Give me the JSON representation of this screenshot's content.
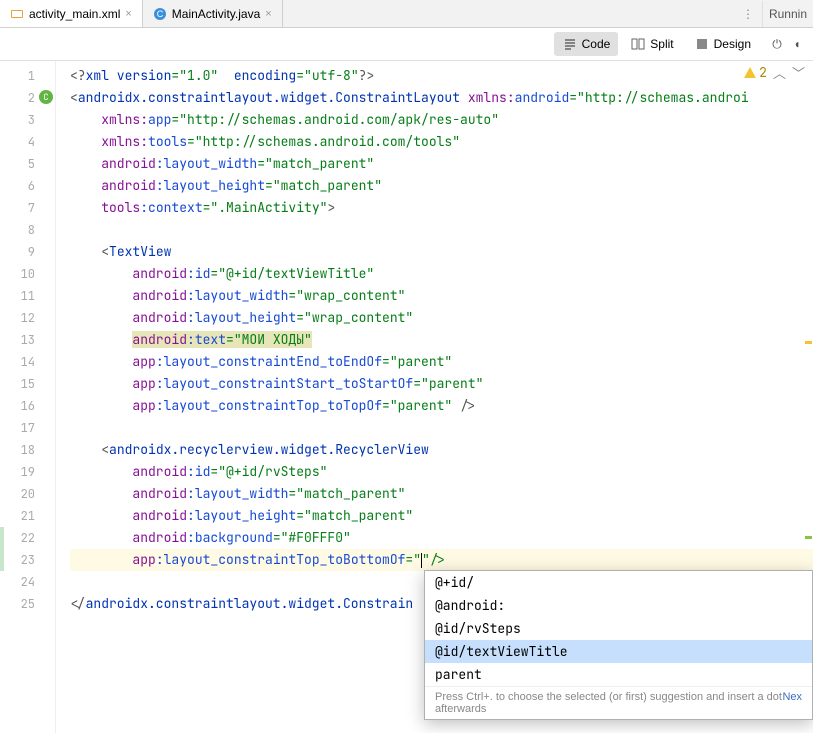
{
  "tabs": [
    {
      "label": "activity_main.xml",
      "active": true
    },
    {
      "label": "MainActivity.java",
      "active": false
    }
  ],
  "right_panel": "Runnin",
  "view_modes": [
    {
      "label": "Code",
      "active": true
    },
    {
      "label": "Split",
      "active": false
    },
    {
      "label": "Design",
      "active": false
    }
  ],
  "warnings": {
    "count": "2"
  },
  "line_numbers": [
    "1",
    "2",
    "3",
    "4",
    "5",
    "6",
    "7",
    "8",
    "9",
    "10",
    "11",
    "12",
    "13",
    "14",
    "15",
    "16",
    "17",
    "18",
    "19",
    "20",
    "21",
    "22",
    "23",
    "24",
    "25"
  ],
  "code": {
    "l1": {
      "a": "<?",
      "b": "xml version",
      "c": "=\"1.0\"",
      "d": "  encoding",
      "e": "=\"utf-8\"",
      "f": "?>"
    },
    "l2": {
      "a": "<",
      "b": "androidx.constraintlayout.widget.ConstraintLayout ",
      "c": "xmlns:",
      "d": "android",
      "e": "=\"http://schemas.androi"
    },
    "l3": {
      "a": "    ",
      "b": "xmlns:",
      "c": "app",
      "d": "=\"http://schemas.android.com/apk/res-auto\""
    },
    "l4": {
      "a": "    ",
      "b": "xmlns:",
      "c": "tools",
      "d": "=\"http://schemas.android.com/tools\""
    },
    "l5": {
      "a": "    ",
      "b": "android",
      "c": ":layout_width",
      "d": "=\"match_parent\""
    },
    "l6": {
      "a": "    ",
      "b": "android",
      "c": ":layout_height",
      "d": "=\"match_parent\""
    },
    "l7": {
      "a": "    ",
      "b": "tools",
      "c": ":context",
      "d": "=\".MainActivity\"",
      "e": ">"
    },
    "l9": {
      "a": "    <",
      "b": "TextView"
    },
    "l10": {
      "a": "        ",
      "b": "android",
      "c": ":id",
      "d": "=\"@+id/textViewTitle\""
    },
    "l11": {
      "a": "        ",
      "b": "android",
      "c": ":layout_width",
      "d": "=\"wrap_content\""
    },
    "l12": {
      "a": "        ",
      "b": "android",
      "c": ":layout_height",
      "d": "=\"wrap_content\""
    },
    "l13": {
      "a": "        ",
      "b": "android",
      "c": ":text",
      "d": "=\"МОИ ХОДЫ\""
    },
    "l14": {
      "a": "        ",
      "b": "app",
      "c": ":layout_constraintEnd_toEndOf",
      "d": "=\"parent\""
    },
    "l15": {
      "a": "        ",
      "b": "app",
      "c": ":layout_constraintStart_toStartOf",
      "d": "=\"parent\""
    },
    "l16": {
      "a": "        ",
      "b": "app",
      "c": ":layout_constraintTop_toTopOf",
      "d": "=\"parent\"",
      "e": " />"
    },
    "l18": {
      "a": "    <",
      "b": "androidx.recyclerview.widget.RecyclerView"
    },
    "l19": {
      "a": "        ",
      "b": "android",
      "c": ":id",
      "d": "=\"@+id/rvSteps\""
    },
    "l20": {
      "a": "        ",
      "b": "android",
      "c": ":layout_width",
      "d": "=\"match_parent\""
    },
    "l21": {
      "a": "        ",
      "b": "android",
      "c": ":layout_height",
      "d": "=\"match_parent\""
    },
    "l22": {
      "a": "        ",
      "b": "android",
      "c": ":background",
      "d": "=\"#F0FFF0\""
    },
    "l23": {
      "a": "        ",
      "b": "app",
      "c": ":layout_constraintTop_toBottomOf",
      "d": "=\"",
      "e": "\"/>"
    },
    "l25": {
      "a": "</",
      "b": "androidx.constraintlayout.widget.Constrain"
    }
  },
  "autocomplete": {
    "items": [
      "@+id/",
      "@android:",
      "@id/rvSteps",
      "@id/textViewTitle",
      "parent"
    ],
    "selected_index": 3,
    "hint_left": "Press Ctrl+. to choose the selected (or first) suggestion and insert a dot afterwards",
    "hint_right": "Nex"
  }
}
